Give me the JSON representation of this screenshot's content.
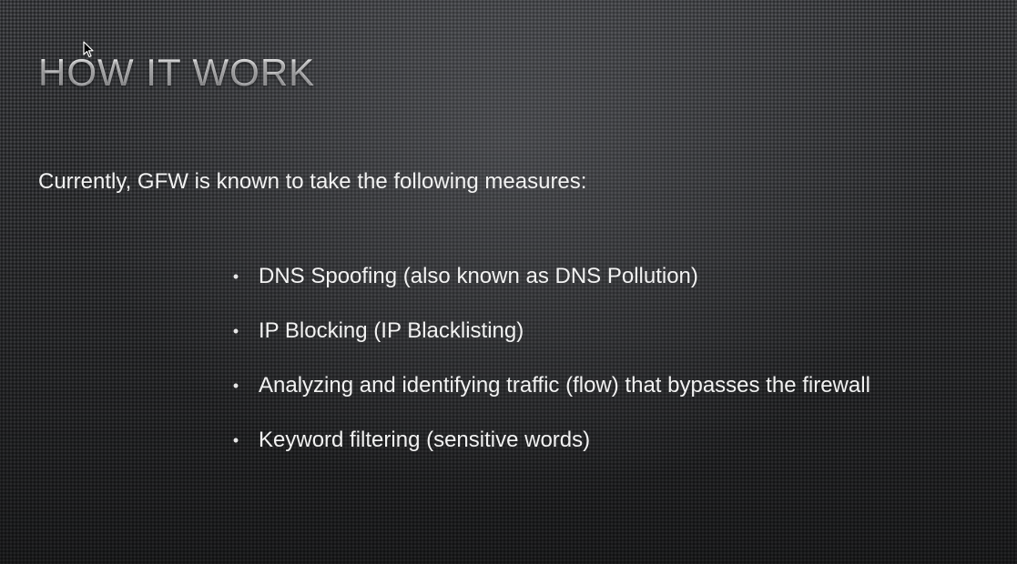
{
  "slide": {
    "title": "HOW IT WORK",
    "intro": "Currently, GFW is known to take the following measures:",
    "bullet_glyph": "•",
    "bullets": [
      "DNS Spoofing (also known as DNS Pollution)",
      "IP Blocking (IP Blacklisting)",
      "Analyzing and identifying traffic (flow) that bypasses the firewall",
      "Keyword filtering (sensitive words)"
    ]
  },
  "cursor": {
    "icon": "mouse-pointer-icon"
  },
  "colors": {
    "background": "#3a3b3e",
    "text": "#f2f2f2",
    "title": "#d7d7d8"
  }
}
